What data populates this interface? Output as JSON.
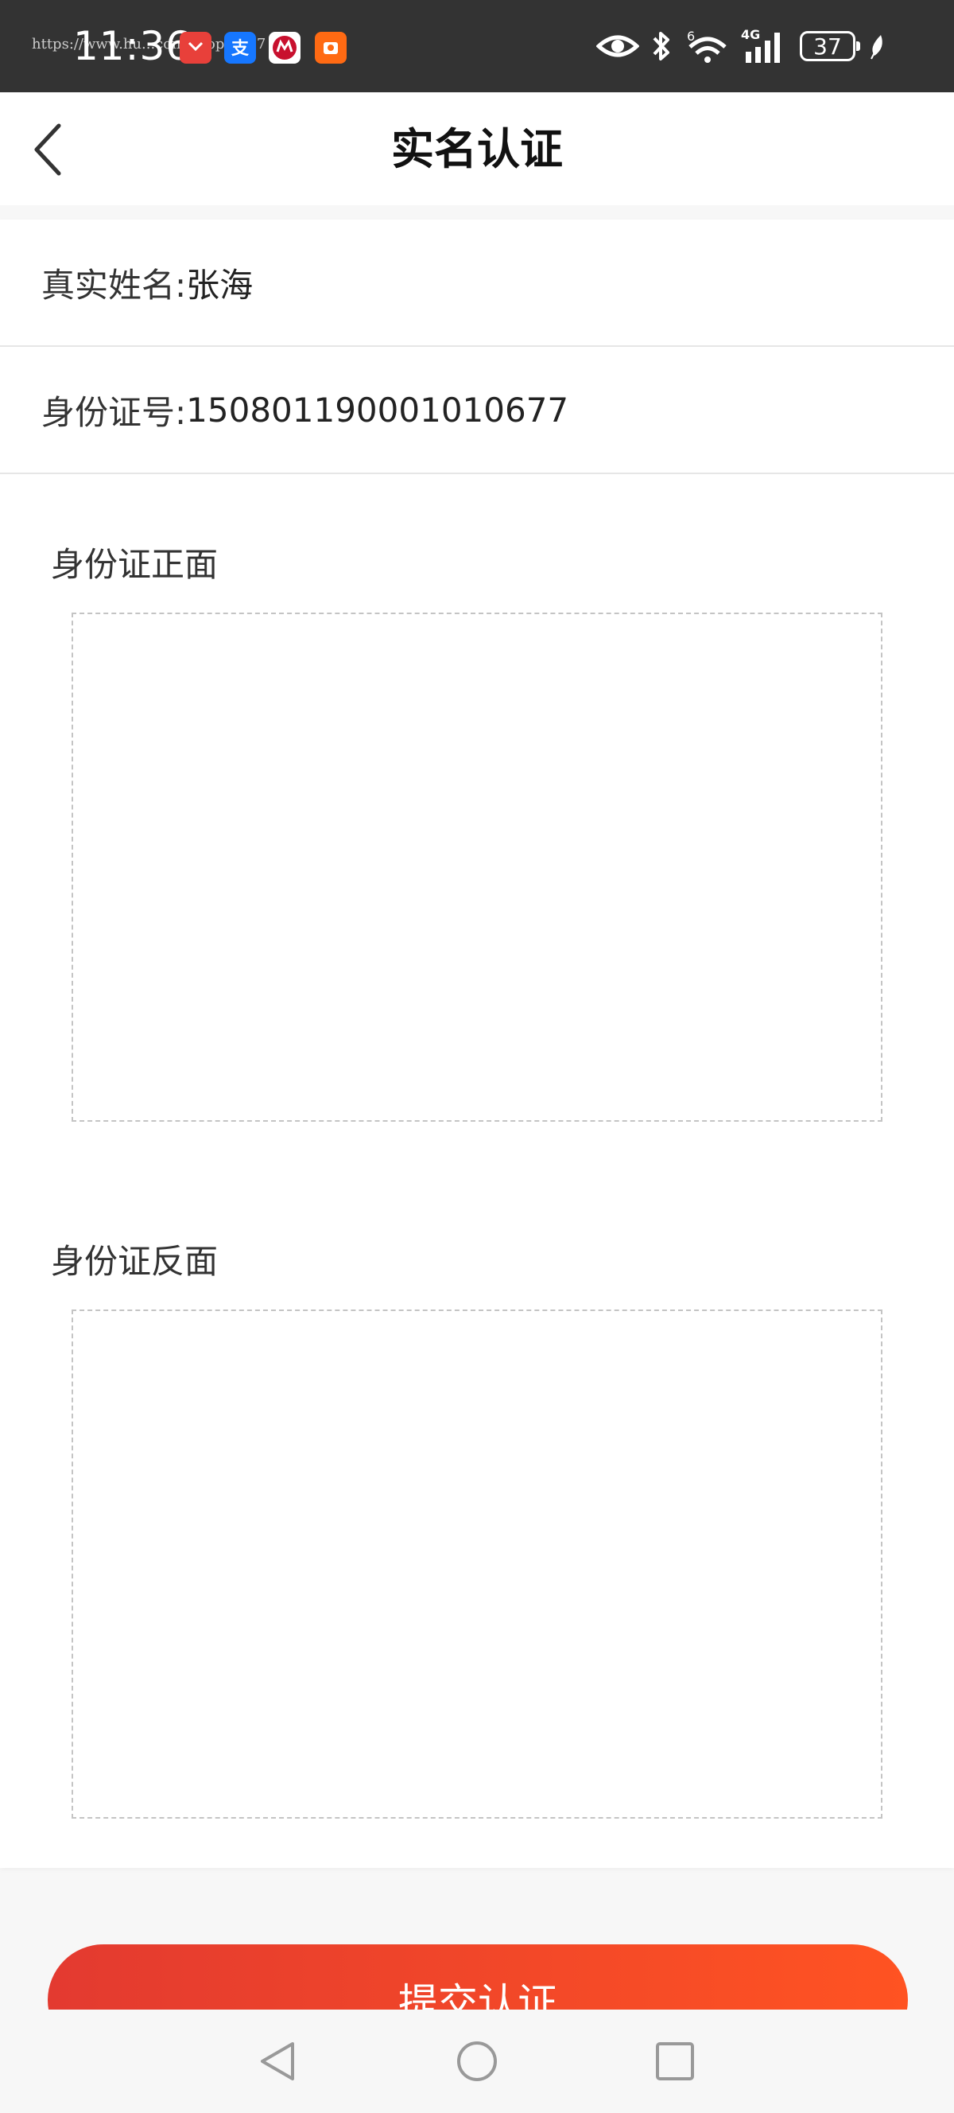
{
  "status_bar": {
    "time": "11:36",
    "url_overlay": "https://www.hu...com/shop/5707",
    "network": "4G",
    "battery": "37",
    "icons": [
      "red-app-icon",
      "alipay-icon",
      "cmb-bank-icon",
      "orange-app-icon",
      "eye-icon",
      "bluetooth-icon",
      "wifi-icon",
      "signal-icon",
      "battery-icon",
      "leaf-icon"
    ],
    "colors": {
      "background": "#333333",
      "foreground": "#ffffff"
    }
  },
  "nav": {
    "title": "实名认证",
    "back_icon": "chevron-left-icon"
  },
  "form": {
    "name_label": "真实姓名:",
    "name_value": "张海",
    "id_label": "身份证号:",
    "id_value": "150801190001010677",
    "front_label": "身份证正面",
    "back_label": "身份证反面"
  },
  "submit": {
    "label": "提交认证",
    "gradient_start": "#e33a30",
    "gradient_end": "#ff5322"
  },
  "system_nav": {
    "icons": [
      "back-triangle-icon",
      "home-circle-icon",
      "recent-square-icon"
    ]
  }
}
